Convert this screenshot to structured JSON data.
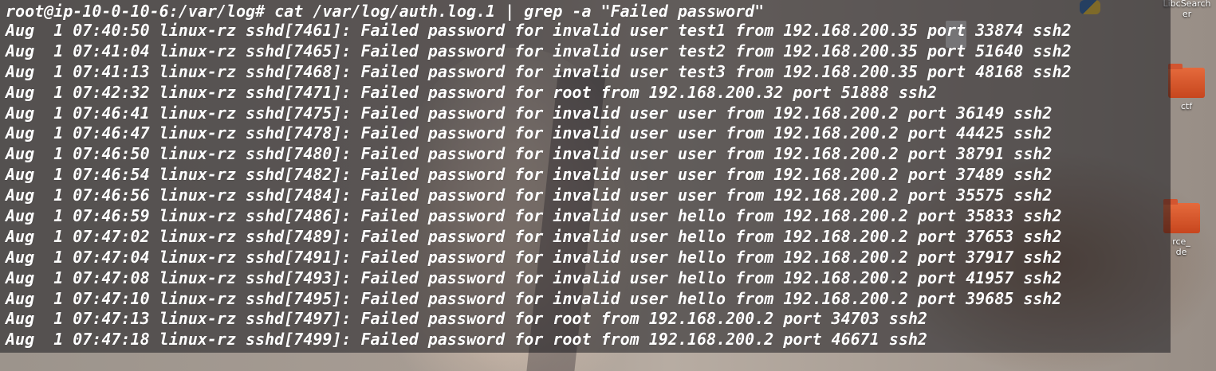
{
  "desktop": {
    "icons": [
      {
        "label": "LibcSearcher",
        "label_lines": [
          "LibcSearch",
          "er"
        ],
        "icon": "document-icon"
      },
      {
        "label": "ctf",
        "icon": "folder-icon",
        "color": "#d95a30"
      },
      {
        "label": "source_code",
        "label_lines": [
          "rce_",
          "de"
        ],
        "icon": "folder-icon"
      },
      {
        "label": "",
        "icon": "python-icon"
      }
    ]
  },
  "terminal": {
    "prompt": "root@ip-10-0-10-6:/var/log# cat /var/log/auth.log.1 | grep -a \"Failed password\"",
    "lines": [
      "Aug  1 07:40:50 linux-rz sshd[7461]: Failed password for invalid user test1 from 192.168.200.35 port 33874 ssh2",
      "Aug  1 07:41:04 linux-rz sshd[7465]: Failed password for invalid user test2 from 192.168.200.35 port 51640 ssh2",
      "Aug  1 07:41:13 linux-rz sshd[7468]: Failed password for invalid user test3 from 192.168.200.35 port 48168 ssh2",
      "Aug  1 07:42:32 linux-rz sshd[7471]: Failed password for root from 192.168.200.32 port 51888 ssh2",
      "Aug  1 07:46:41 linux-rz sshd[7475]: Failed password for invalid user user from 192.168.200.2 port 36149 ssh2",
      "Aug  1 07:46:47 linux-rz sshd[7478]: Failed password for invalid user user from 192.168.200.2 port 44425 ssh2",
      "Aug  1 07:46:50 linux-rz sshd[7480]: Failed password for invalid user user from 192.168.200.2 port 38791 ssh2",
      "Aug  1 07:46:54 linux-rz sshd[7482]: Failed password for invalid user user from 192.168.200.2 port 37489 ssh2",
      "Aug  1 07:46:56 linux-rz sshd[7484]: Failed password for invalid user user from 192.168.200.2 port 35575 ssh2",
      "Aug  1 07:46:59 linux-rz sshd[7486]: Failed password for invalid user hello from 192.168.200.2 port 35833 ssh2",
      "Aug  1 07:47:02 linux-rz sshd[7489]: Failed password for invalid user hello from 192.168.200.2 port 37653 ssh2",
      "Aug  1 07:47:04 linux-rz sshd[7491]: Failed password for invalid user hello from 192.168.200.2 port 37917 ssh2",
      "Aug  1 07:47:08 linux-rz sshd[7493]: Failed password for invalid user hello from 192.168.200.2 port 41957 ssh2",
      "Aug  1 07:47:10 linux-rz sshd[7495]: Failed password for invalid user hello from 192.168.200.2 port 39685 ssh2",
      "Aug  1 07:47:13 linux-rz sshd[7497]: Failed password for root from 192.168.200.2 port 34703 ssh2",
      "Aug  1 07:47:18 linux-rz sshd[7499]: Failed password for root from 192.168.200.2 port 46671 ssh2"
    ],
    "text_color": "#ffffff"
  }
}
